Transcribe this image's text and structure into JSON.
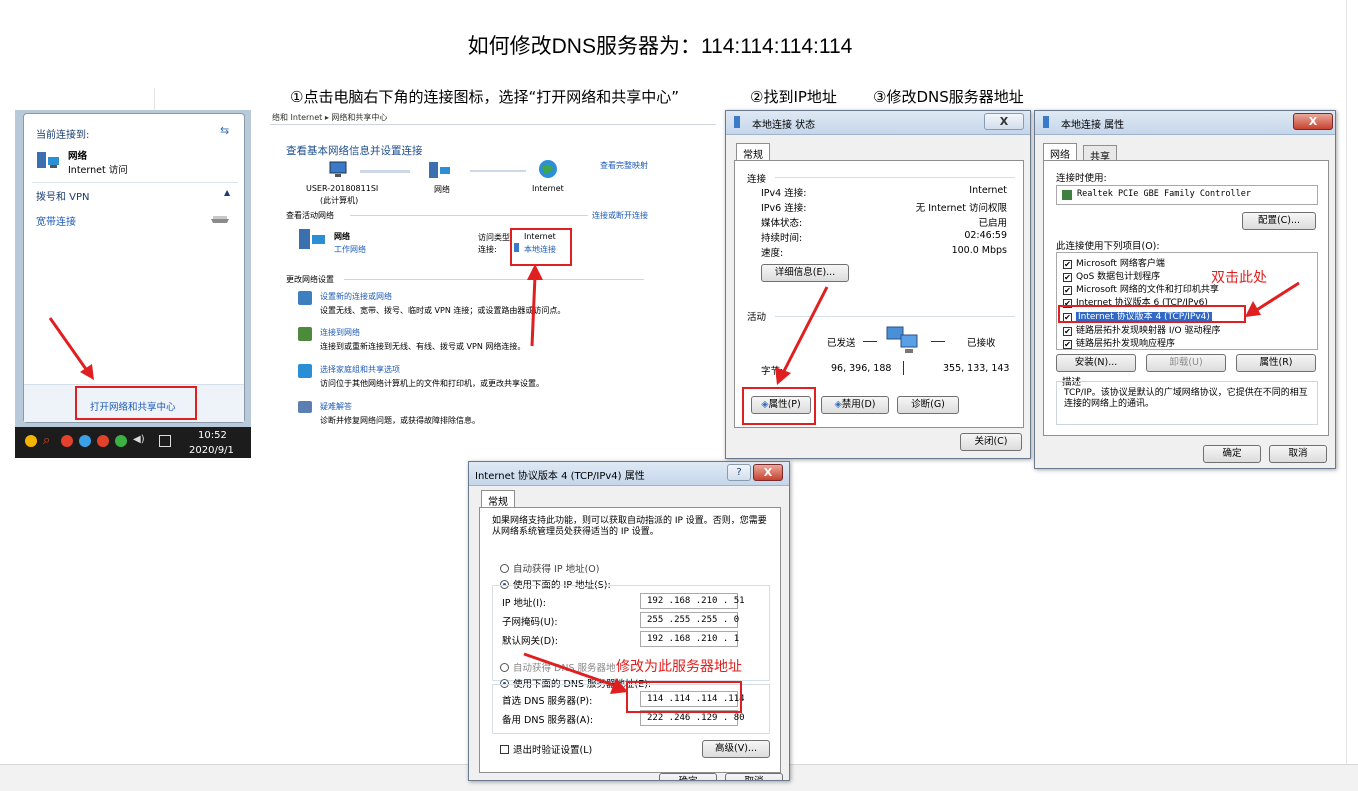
{
  "title": "如何修改DNS服务器为：114:114:114:114",
  "steps": {
    "step1": "①点击电脑右下角的连接图标，选择“打开网络和共享中心”",
    "step2": "②找到IP地址",
    "step3": "③修改DNS服务器地址"
  },
  "tray_popup": {
    "current_label": "当前连接到:",
    "network_name": "网络",
    "network_access": "Internet 访问",
    "dialup_header": "拨号和 VPN",
    "broadband": "宽带连接",
    "open_center": "打开网络和共享中心",
    "clock_time": "10:52",
    "clock_date": "2020/9/1"
  },
  "sharing_center": {
    "breadcrumb": "络和 Internet ▸ 网络和共享中心",
    "heading": "查看基本网络信息并设置连接",
    "view_full_map": "查看完整映射",
    "computer_name": "USER-20180811SI",
    "computer_sub": "(此计算机)",
    "node_network": "网络",
    "node_internet": "Internet",
    "active_networks": "查看活动网络",
    "connect_disconnect": "连接或断开连接",
    "net_name": "网络",
    "net_type": "工作网络",
    "access_type_label": "访问类型:",
    "access_type_value": "Internet",
    "connection_label": "连接:",
    "connection_value": "本地连接",
    "change_settings": "更改网络设置",
    "tasks": [
      {
        "title": "设置新的连接或网络",
        "desc": "设置无线、宽带、拨号、临时或 VPN 连接；或设置路由器或访问点。"
      },
      {
        "title": "连接到网络",
        "desc": "连接到或重新连接到无线、有线、拨号或 VPN 网络连接。"
      },
      {
        "title": "选择家庭组和共享选项",
        "desc": "访问位于其他网络计算机上的文件和打印机，或更改共享设置。"
      },
      {
        "title": "疑难解答",
        "desc": "诊断并修复网络问题，或获得故障排除信息。"
      }
    ]
  },
  "status_dialog": {
    "title": "本地连接 状态",
    "close_x": "X",
    "tab_general": "常规",
    "connection_header": "连接",
    "rows": [
      {
        "label": "IPv4 连接:",
        "value": "Internet"
      },
      {
        "label": "IPv6 连接:",
        "value": "无 Internet 访问权限"
      },
      {
        "label": "媒体状态:",
        "value": "已启用"
      },
      {
        "label": "持续时间:",
        "value": "02:46:59"
      },
      {
        "label": "速度:",
        "value": "100.0 Mbps"
      }
    ],
    "details_button": "详细信息(E)...",
    "activity_header": "活动",
    "sent_label": "已发送",
    "received_label": "已接收",
    "bytes_label": "字节:",
    "bytes_sent": "96, 396, 188",
    "bytes_received": "355, 133, 143",
    "properties_button": "属性(P)",
    "disable_button": "禁用(D)",
    "diagnose_button": "诊断(G)",
    "close_button": "关闭(C)"
  },
  "properties_dialog": {
    "title": "本地连接 属性",
    "close_x": "X",
    "tab_network": "网络",
    "tab_sharing": "共享",
    "connect_using": "连接时使用:",
    "adapter": "Realtek PCIe GBE Family Controller",
    "configure_button": "配置(C)...",
    "items_label": "此连接使用下列项目(O):",
    "items": [
      "Microsoft 网络客户端",
      "QoS 数据包计划程序",
      "Microsoft 网络的文件和打印机共享",
      "Internet 协议版本 6 (TCP/IPv6)",
      "Internet 协议版本 4 (TCP/IPv4)",
      "链路层拓扑发现映射器 I/O 驱动程序",
      "链路层拓扑发现响应程序"
    ],
    "annotation": "双击此处",
    "install_button": "安装(N)...",
    "uninstall_button": "卸载(U)",
    "properties_button": "属性(R)",
    "description_header": "描述",
    "description": "TCP/IP。该协议是默认的广域网络协议，它提供在不同的相互连接的网络上的通讯。",
    "ok_button": "确定",
    "cancel_button": "取消"
  },
  "ipv4_dialog": {
    "title": "Internet 协议版本 4 (TCP/IPv4) 属性",
    "help": "?",
    "close_x": "X",
    "tab_general": "常规",
    "intro": "如果网络支持此功能，则可以获取自动指派的 IP 设置。否则，您需要从网络系统管理员处获得适当的 IP 设置。",
    "auto_ip": "自动获得 IP 地址(O)",
    "manual_ip": "使用下面的 IP 地址(S):",
    "ip_label": "IP 地址(I):",
    "ip_value": "192 .168 .210 . 51",
    "mask_label": "子网掩码(U):",
    "mask_value": "255 .255 .255 . 0",
    "gateway_label": "默认网关(D):",
    "gateway_value": "192 .168 .210 . 1",
    "auto_dns": "自动获得 DNS 服务器地址(B)",
    "manual_dns": "使用下面的 DNS 服务器地址(E):",
    "preferred_label": "首选 DNS 服务器(P):",
    "preferred_value": "114 .114 .114 .114",
    "alternate_label": "备用 DNS 服务器(A):",
    "alternate_value": "222 .246 .129 . 80",
    "annotation": "修改为此服务器地址",
    "validate": "退出时验证设置(L)",
    "advanced_button": "高级(V)...",
    "ok_button": "确定",
    "cancel_button": "取消"
  },
  "colors": {
    "annotation_red": "#e02020",
    "link_blue": "#1e5bb8",
    "taskbar": "#1c1c1c",
    "tray_highlight": "#c0392b"
  }
}
